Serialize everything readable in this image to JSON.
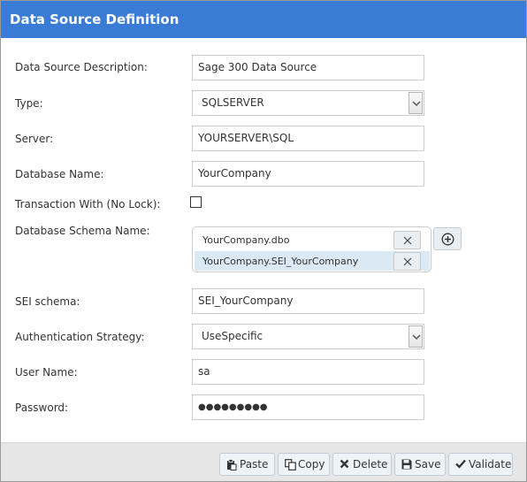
{
  "dialog": {
    "title": "Data Source Definition"
  },
  "form": {
    "description": {
      "label": "Data Source Description:",
      "value": "Sage 300 Data Source"
    },
    "type": {
      "label": "Type:",
      "value": "SQLSERVER"
    },
    "server": {
      "label": "Server:",
      "value": "YOURSERVER\\SQL"
    },
    "database": {
      "label": "Database Name:",
      "value": "YourCompany"
    },
    "nolock": {
      "label": "Transaction With (No Lock):",
      "checked": false
    },
    "schema": {
      "label": "Database Schema Name:",
      "items": [
        {
          "name": "YourCompany.dbo",
          "selected": false
        },
        {
          "name": "YourCompany.SEI_YourCompany",
          "selected": true
        }
      ]
    },
    "sei_schema": {
      "label": "SEI schema:",
      "value": "SEI_YourCompany"
    },
    "auth": {
      "label": "Authentication Strategy:",
      "value": "UseSpecific"
    },
    "username": {
      "label": "User Name:",
      "value": "sa"
    },
    "password": {
      "label": "Password:",
      "value": "●●●●●●●●●"
    }
  },
  "footer": {
    "paste": "Paste",
    "copy": "Copy",
    "delete": "Delete",
    "save": "Save",
    "validate": "Validate"
  },
  "colors": {
    "titlebar": "#3a7bd5",
    "footer": "#e6e6e6",
    "selected_row": "#dbe9f5"
  }
}
